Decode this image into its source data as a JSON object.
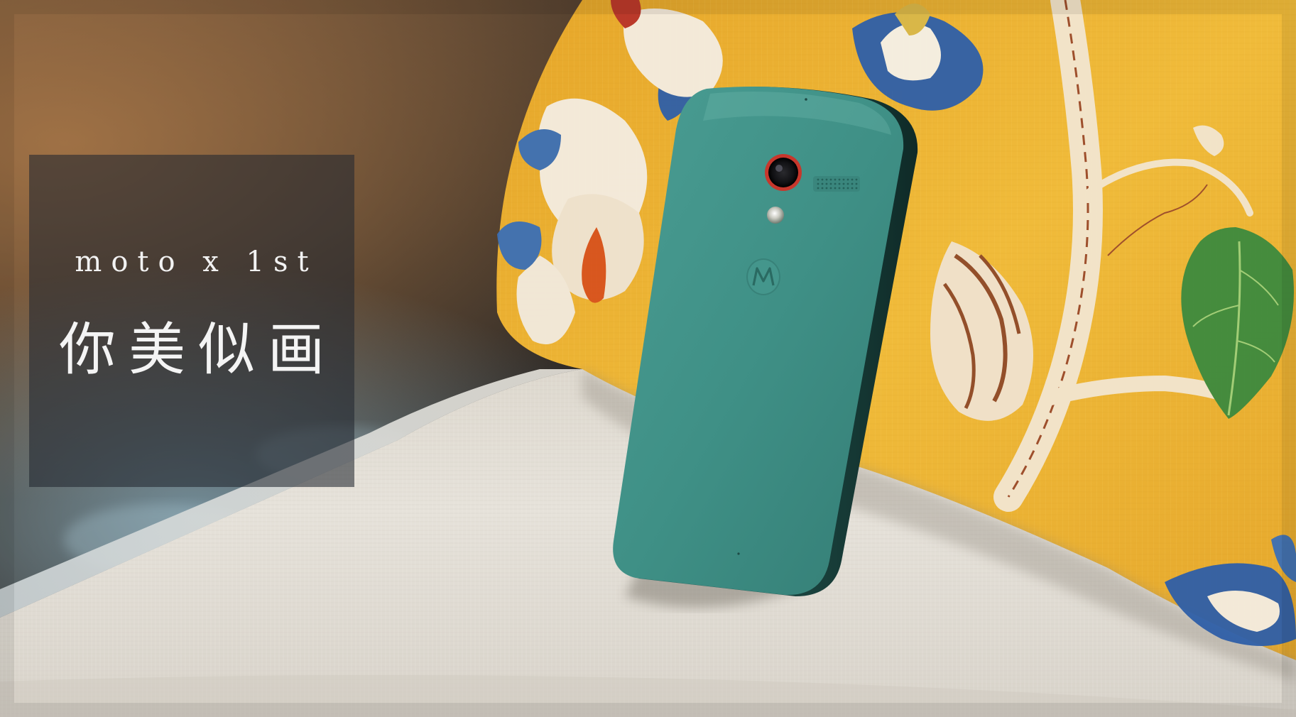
{
  "caption": {
    "subtitle": "moto x 1st",
    "title": "你美似画"
  },
  "colors": {
    "phone_body": "#3f8f86",
    "pillow": "#e9b331",
    "sofa": "#e4e0d8",
    "caption_box": "#232830"
  },
  "icons": {
    "brand_logo": "motorola-m-logo"
  }
}
